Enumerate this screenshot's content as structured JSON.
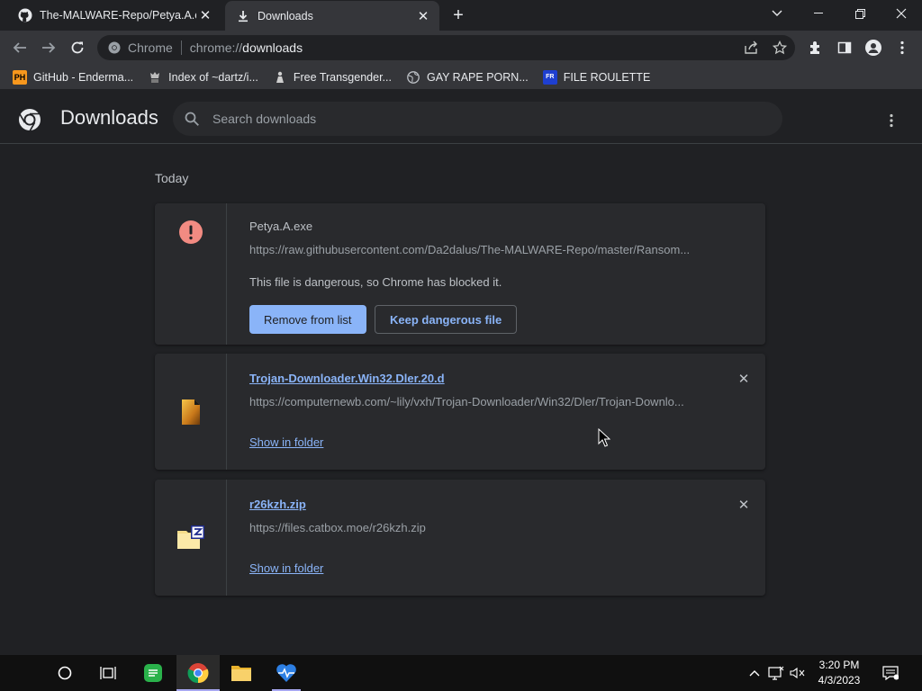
{
  "tabs": [
    {
      "title": "The-MALWARE-Repo/Petya.A.exe",
      "icon": "github-icon",
      "active": false
    },
    {
      "title": "Downloads",
      "icon": "download-icon",
      "active": true
    }
  ],
  "toolbar": {
    "chip_label": "Chrome",
    "url_scheme": "chrome://",
    "url_host": "downloads"
  },
  "bookmarks": [
    {
      "label": "GitHub - Enderma...",
      "icon": "ph-icon"
    },
    {
      "label": "Index of ~dartz/i...",
      "icon": "anime-icon"
    },
    {
      "label": "Free Transgender...",
      "icon": "figure-icon"
    },
    {
      "label": "GAY RAPE PORN...",
      "icon": "globe-icon"
    },
    {
      "label": "FILE ROULETTE",
      "icon": "fileroulette-icon"
    }
  ],
  "page": {
    "title": "Downloads",
    "search_placeholder": "Search downloads",
    "date_header": "Today"
  },
  "downloads": [
    {
      "name": "Petya.A.exe",
      "url": "https://raw.githubusercontent.com/Da2dalus/The-MALWARE-Repo/master/Ransom...",
      "message": "This file is dangerous, so Chrome has blocked it.",
      "primary_action": "Remove from list",
      "secondary_action": "Keep dangerous file",
      "icon": "danger-icon"
    },
    {
      "name": "Trojan-Downloader.Win32.Dler.20.d",
      "url": "https://computernewb.com/~lily/vxh/Trojan-Downloader/Win32/Dler/Trojan-Downlo...",
      "action": "Show in folder",
      "icon": "file-icon"
    },
    {
      "name": "r26kzh.zip",
      "url": "https://files.catbox.moe/r26kzh.zip",
      "action": "Show in folder",
      "icon": "zip-icon"
    }
  ],
  "taskbar": {
    "time": "3:20 PM",
    "date": "4/3/2023"
  },
  "colors": {
    "accent": "#8ab4f8",
    "background": "#202124",
    "card": "#292a2d",
    "danger": "#f28b82"
  }
}
